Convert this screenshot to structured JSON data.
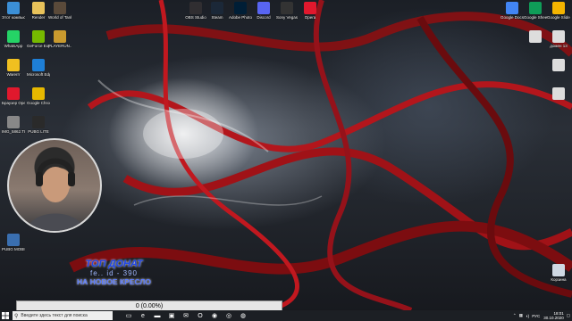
{
  "desktop": {
    "left_icons": [
      {
        "label": "Этот компьютер",
        "icon": "computer-icon",
        "color": "#3b8fd6"
      },
      {
        "label": "Render",
        "icon": "folder-icon",
        "color": "#e8c25a"
      },
      {
        "label": "World of Tanks",
        "icon": "tank-game-icon",
        "color": "#5a4a3a"
      },
      {
        "label": "WhatsApp",
        "icon": "whatsapp-icon",
        "color": "#25d366"
      },
      {
        "label": "GeForce Experience",
        "icon": "nvidia-icon",
        "color": "#76b900"
      },
      {
        "label": "PLAYERUN... BATTLEGR...",
        "icon": "pubg-icon",
        "color": "#c99a2e"
      },
      {
        "label": "Warerrr",
        "icon": "lightning-icon",
        "color": "#f0c020"
      },
      {
        "label": "Microsoft Edge",
        "icon": "edge-icon",
        "color": "#1e7fd6"
      },
      {
        "label": "Браузер Opera",
        "icon": "opera-icon",
        "color": "#e0182d"
      },
      {
        "label": "Google Chrome",
        "icon": "chrome-icon",
        "color": "#e6b800"
      },
      {
        "label": "IMG_5862.TI",
        "icon": "image-file-icon",
        "color": "#888888"
      },
      {
        "label": "PUBG LITE",
        "icon": "pubg-lite-icon",
        "color": "#2a2a2a"
      },
      {
        "label": "PUBG MOBILE",
        "icon": "pubg-mobile-icon",
        "color": "#3a6fb0"
      }
    ],
    "top_icons": [
      {
        "label": "OBS Studio",
        "icon": "obs-icon",
        "color": "#302e31"
      },
      {
        "label": "Steam",
        "icon": "steam-icon",
        "color": "#1b2838"
      },
      {
        "label": "Adobe Photosh...",
        "icon": "photoshop-icon",
        "color": "#001e36"
      },
      {
        "label": "Discord",
        "icon": "discord-icon",
        "color": "#5865f2"
      },
      {
        "label": "Sony Vegas",
        "icon": "film-icon",
        "color": "#333333"
      },
      {
        "label": "Opera",
        "icon": "opera-icon",
        "color": "#e0182d"
      }
    ],
    "right_icons": [
      {
        "label": "Google Docs",
        "icon": "google-docs-icon",
        "color": "#4285f4"
      },
      {
        "label": "Google Sheets",
        "icon": "google-sheets-icon",
        "color": "#0f9d58"
      },
      {
        "label": "Google Slides",
        "icon": "google-slides-icon",
        "color": "#f4b400"
      },
      {
        "label": "",
        "icon": "document-icon",
        "color": "#dddddd"
      },
      {
        "label": "домен 13",
        "icon": "document-icon",
        "color": "#dddddd"
      },
      {
        "label": "",
        "icon": "document-icon",
        "color": "#dddddd"
      },
      {
        "label": "",
        "icon": "document-icon",
        "color": "#dddddd"
      },
      {
        "label": "Корзина",
        "icon": "recycle-bin-icon",
        "color": "#cfd8e3"
      }
    ]
  },
  "overlay": {
    "title": "ТОП ДОНАТ",
    "subtitle": "fe.. id - 390",
    "goal": "НА НОВОЕ КРЕСЛО",
    "progress": {
      "text": "0 (0.00%)",
      "fraction": 0.0
    }
  },
  "taskbar": {
    "search_placeholder": "Введите здесь текст для поиска",
    "apps": [
      {
        "icon": "task-view-icon",
        "glyph": "▭"
      },
      {
        "icon": "edge-icon",
        "glyph": "e"
      },
      {
        "icon": "folder-icon",
        "glyph": "▬"
      },
      {
        "icon": "store-icon",
        "glyph": "▣"
      },
      {
        "icon": "mail-icon",
        "glyph": "✉"
      },
      {
        "icon": "opera-icon",
        "glyph": "O"
      },
      {
        "icon": "obs-icon",
        "glyph": "◉"
      },
      {
        "icon": "steam-icon",
        "glyph": "◎"
      },
      {
        "icon": "chrome-icon",
        "glyph": "◍"
      }
    ],
    "tray": {
      "lang": "РУС",
      "time": "18:01",
      "date": "30.10.2020"
    }
  }
}
